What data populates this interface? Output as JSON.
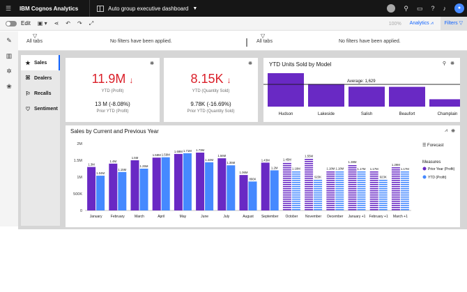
{
  "topbar": {
    "menu_icon": "menu-icon",
    "brand": "IBM Cognos Analytics",
    "dashboard_title": "Auto group executive dashboard",
    "chevron": "▾",
    "icons": [
      "assistant-icon",
      "search-icon",
      "chat-icon",
      "help-icon",
      "notification-icon",
      "user-avatar"
    ]
  },
  "toolbar": {
    "edit_label": "Edit",
    "zoom": "100%",
    "analytics_label": "Analytics",
    "filters_label": "Filters"
  },
  "filterbar": {
    "left_label": "All tabs",
    "left_msg": "No filters have been applied.",
    "right_label": "All tabs",
    "right_msg": "No filters have been applied."
  },
  "tabs": [
    {
      "label": "Sales",
      "icon": "star-icon"
    },
    {
      "label": "Dealers",
      "icon": "people-icon"
    },
    {
      "label": "Recalls",
      "icon": "recall-icon"
    },
    {
      "label": "Sentiment",
      "icon": "heart-icon"
    }
  ],
  "kpi1": {
    "value": "11.9M",
    "arrow": "↓",
    "label": "YTD (Profit)",
    "prior_value": "13 M (-8.08%)",
    "prior_label": "Prior YTD (Profit)"
  },
  "kpi2": {
    "value": "8.15K",
    "arrow": "↓",
    "label": "YTD (Quantity Sold)",
    "prior_value": "9.78K (-16.69%)",
    "prior_label": "Prior YTD (Quantity Sold)"
  },
  "ytd_model": {
    "title": "YTD Units Sold by Model",
    "average_label": "Average: 1,629",
    "average_value": 1629,
    "models": [
      "Hudson",
      "Lakeside",
      "Salish",
      "Beaufort",
      "Champlain"
    ],
    "values": [
      2450,
      1660,
      1460,
      1450,
      540
    ],
    "color": "#6929c4"
  },
  "main_chart": {
    "title": "Sales by Current and Previous Year",
    "forecast_label": "Forecast",
    "legend_title": "Measures",
    "y_ticks": [
      "2M",
      "1.5M",
      "1M",
      "500K",
      "0"
    ]
  },
  "chart_data": {
    "type": "bar",
    "title": "Sales by Current and Previous Year",
    "ylim": [
      0,
      2000000
    ],
    "categories": [
      "January",
      "February",
      "March",
      "April",
      "May",
      "June",
      "July",
      "August",
      "September",
      "October",
      "November",
      "December",
      "January +1",
      "February +1",
      "March +1"
    ],
    "series": [
      {
        "name": "Prior Year (Profit)",
        "color": "#6929c4",
        "values": [
          1300000,
          1400000,
          1500000,
          1580000,
          1690000,
          1730000,
          1560000,
          1060000,
          1430000,
          1450000,
          1550000,
          1180000,
          1380000,
          1170000,
          1290000
        ],
        "labels": [
          "1.3M",
          "1.4M",
          "1.5M",
          "1.58M",
          "1.69M",
          "1.73M",
          "1.56M",
          "1.06M",
          "1.43M",
          "1.45M",
          "1.55M",
          "1.18M",
          "1.38M",
          "1.17M",
          "1.29M"
        ]
      },
      {
        "name": "YTD (Profit)",
        "color": "#4589ff",
        "values": [
          1040000,
          1150000,
          1250000,
          1590000,
          1710000,
          1440000,
          1350000,
          866000,
          1200000,
          1180000,
          923000,
          1180000,
          1170000,
          923000,
          1170000
        ],
        "labels": [
          "1.04M",
          "1.15M",
          "1.25M",
          "1.59M",
          "1.71M",
          "1.44M",
          "1.35M",
          "866K",
          "1.2M",
          "1.18M",
          "923K",
          "1.18M",
          "1.17M",
          "923K",
          "1.17M"
        ]
      }
    ],
    "forecast_start_index": 9
  }
}
